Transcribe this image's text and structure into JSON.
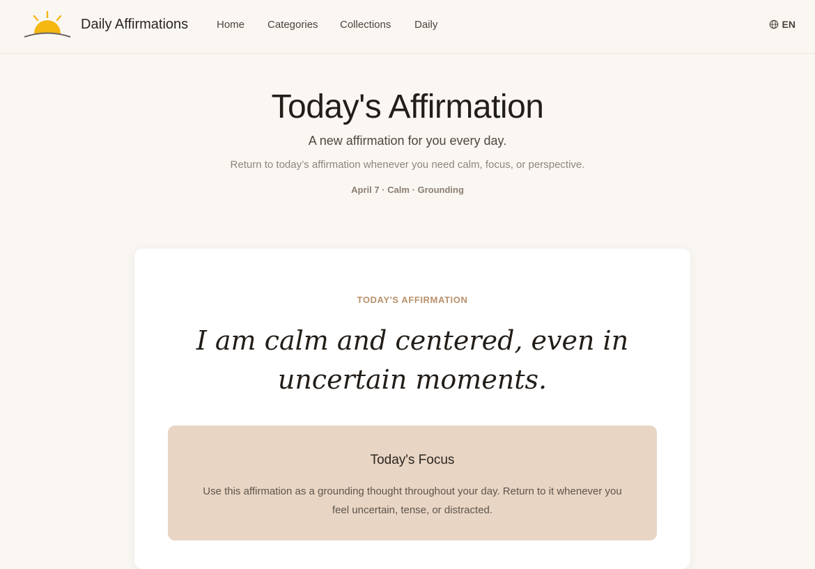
{
  "header": {
    "brand": "Daily Affirmations",
    "logo_icon": "sunrise-icon",
    "nav": [
      {
        "label": "Home"
      },
      {
        "label": "Categories"
      },
      {
        "label": "Collections"
      },
      {
        "label": "Daily"
      }
    ],
    "language": {
      "icon": "globe-icon",
      "label": "EN"
    }
  },
  "hero": {
    "title": "Today's Affirmation",
    "subtitle": "A new affirmation for you every day.",
    "description": "Return to today’s affirmation whenever you need calm, focus, or perspective.",
    "meta": "April 7 · Calm · Grounding"
  },
  "card": {
    "label": "TODAY'S AFFIRMATION",
    "quote": "I am calm and centered, even in uncertain moments.",
    "focus": {
      "title": "Today's Focus",
      "text": "Use this affirmation as a grounding thought throughout your day. Return to it whenever you feel uncertain, tense, or distracted."
    }
  },
  "colors": {
    "background": "#faf7f3",
    "accent_label": "#b8906a",
    "focus_box": "#e8d5c4",
    "sun": "#f5b712"
  }
}
